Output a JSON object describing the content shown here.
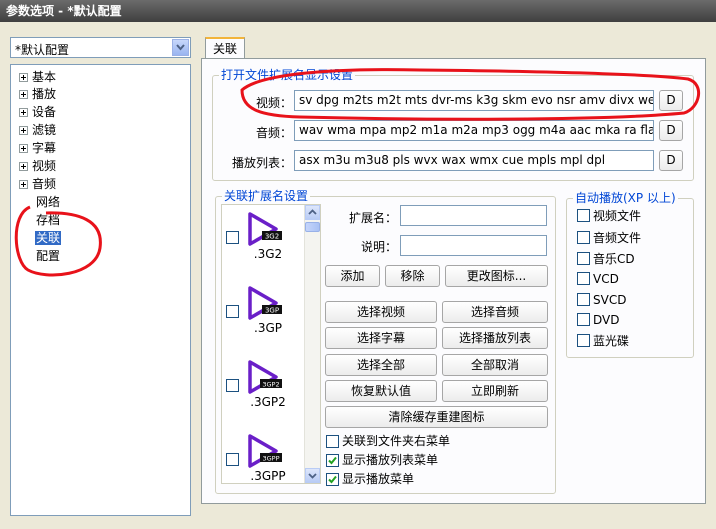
{
  "window": {
    "title": "参数选项 - *默认配置"
  },
  "profile": {
    "selected": "*默认配置"
  },
  "tree": {
    "items": [
      {
        "label": "基本",
        "expandable": true
      },
      {
        "label": "播放",
        "expandable": true
      },
      {
        "label": "设备",
        "expandable": true
      },
      {
        "label": "滤镜",
        "expandable": true
      },
      {
        "label": "字幕",
        "expandable": true
      },
      {
        "label": "视频",
        "expandable": true
      },
      {
        "label": "音频",
        "expandable": true
      },
      {
        "label": "网络",
        "expandable": false
      },
      {
        "label": "存档",
        "expandable": false
      },
      {
        "label": "关联",
        "expandable": false,
        "selected": true
      },
      {
        "label": "配置",
        "expandable": false
      }
    ]
  },
  "tab": {
    "label": "关联"
  },
  "ext_display": {
    "title": "打开文件扩展名显示设置",
    "video_label": "视频：",
    "video_value": "sv dpg m2ts m2t mts dvr-ms k3g skm evo nsr amv divx webm wtv",
    "audio_label": "音频：",
    "audio_value": "wav wma mpa mp2 m1a m2a mp3 ogg m4a aac mka ra flac ape",
    "playlist_label": "播放列表：",
    "playlist_value": "asx m3u m3u8 pls wvx wax wmx cue mpls mpl dpl",
    "default_button": "D"
  },
  "assoc": {
    "title": "关联扩展名设置",
    "items": [
      {
        "name": ".3G2",
        "badge": "3G2"
      },
      {
        "name": ".3GP",
        "badge": "3GP"
      },
      {
        "name": ".3GP2",
        "badge": "3GP2"
      },
      {
        "name": ".3GPP",
        "badge": "3GPP"
      }
    ],
    "ext_name_label": "扩展名：",
    "desc_label": "说明：",
    "add_button": "添加",
    "remove_button": "移除",
    "change_icon_button": "更改图标...",
    "select_video": "选择视频",
    "select_audio": "选择音频",
    "select_subtitle": "选择字幕",
    "select_playlist": "选择播放列表",
    "select_all": "选择全部",
    "deselect_all": "全部取消",
    "restore_default": "恢复默认值",
    "refresh_now": "立即刷新",
    "clear_cache": "清除缓存重建图标",
    "folder_context_menu": {
      "label": "关联到文件夹右菜单",
      "checked": false
    },
    "show_playlist_menu": {
      "label": "显示播放列表菜单",
      "checked": true
    },
    "show_play_menu": {
      "label": "显示播放菜单",
      "checked": true
    }
  },
  "autoplay": {
    "title": "自动播放(XP 以上)",
    "items": [
      {
        "label": "视频文件",
        "checked": false
      },
      {
        "label": "音频文件",
        "checked": false
      },
      {
        "label": "音乐CD",
        "checked": false
      },
      {
        "label": "VCD",
        "checked": false
      },
      {
        "label": "SVCD",
        "checked": false
      },
      {
        "label": "DVD",
        "checked": false
      },
      {
        "label": "蓝光碟",
        "checked": false
      }
    ]
  },
  "colors": {
    "accent": "#316ac5",
    "group_title": "#0046d5",
    "play_icon": "#6a1fc8",
    "annotation": "#e8121a"
  }
}
